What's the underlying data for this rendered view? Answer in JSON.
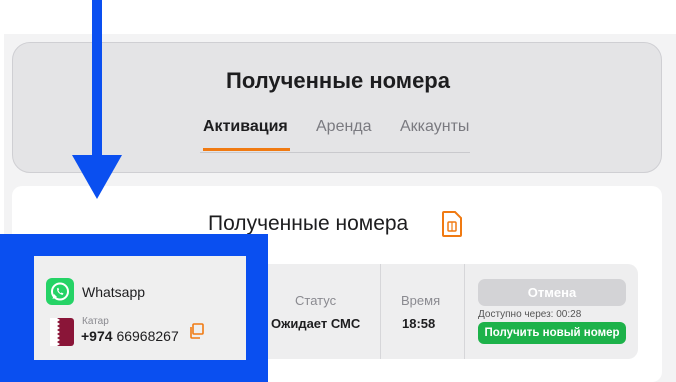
{
  "header": {
    "title": "Полученные номера",
    "tabs": [
      {
        "label": "Активация",
        "active": true
      },
      {
        "label": "Аренда",
        "active": false
      },
      {
        "label": "Аккаунты",
        "active": false
      }
    ]
  },
  "section": {
    "title": "Полученные номера",
    "icon": "sim-card-icon"
  },
  "order": {
    "service": "Whatsapp",
    "service_icon": "whatsapp-icon",
    "country": "Катар",
    "country_code": "+974",
    "number": "66968267",
    "status_label": "Статус",
    "status_value": "Ожидает СМС",
    "time_label": "Время",
    "time_value": "18:58",
    "cancel_label": "Отмена",
    "available_in": "Доступно через: 00:28",
    "new_number_label": "Получить новый номер"
  },
  "colors": {
    "accent": "#f07a12",
    "highlight": "#0a4ff0",
    "success": "#1db24a",
    "whatsapp": "#25d366"
  }
}
